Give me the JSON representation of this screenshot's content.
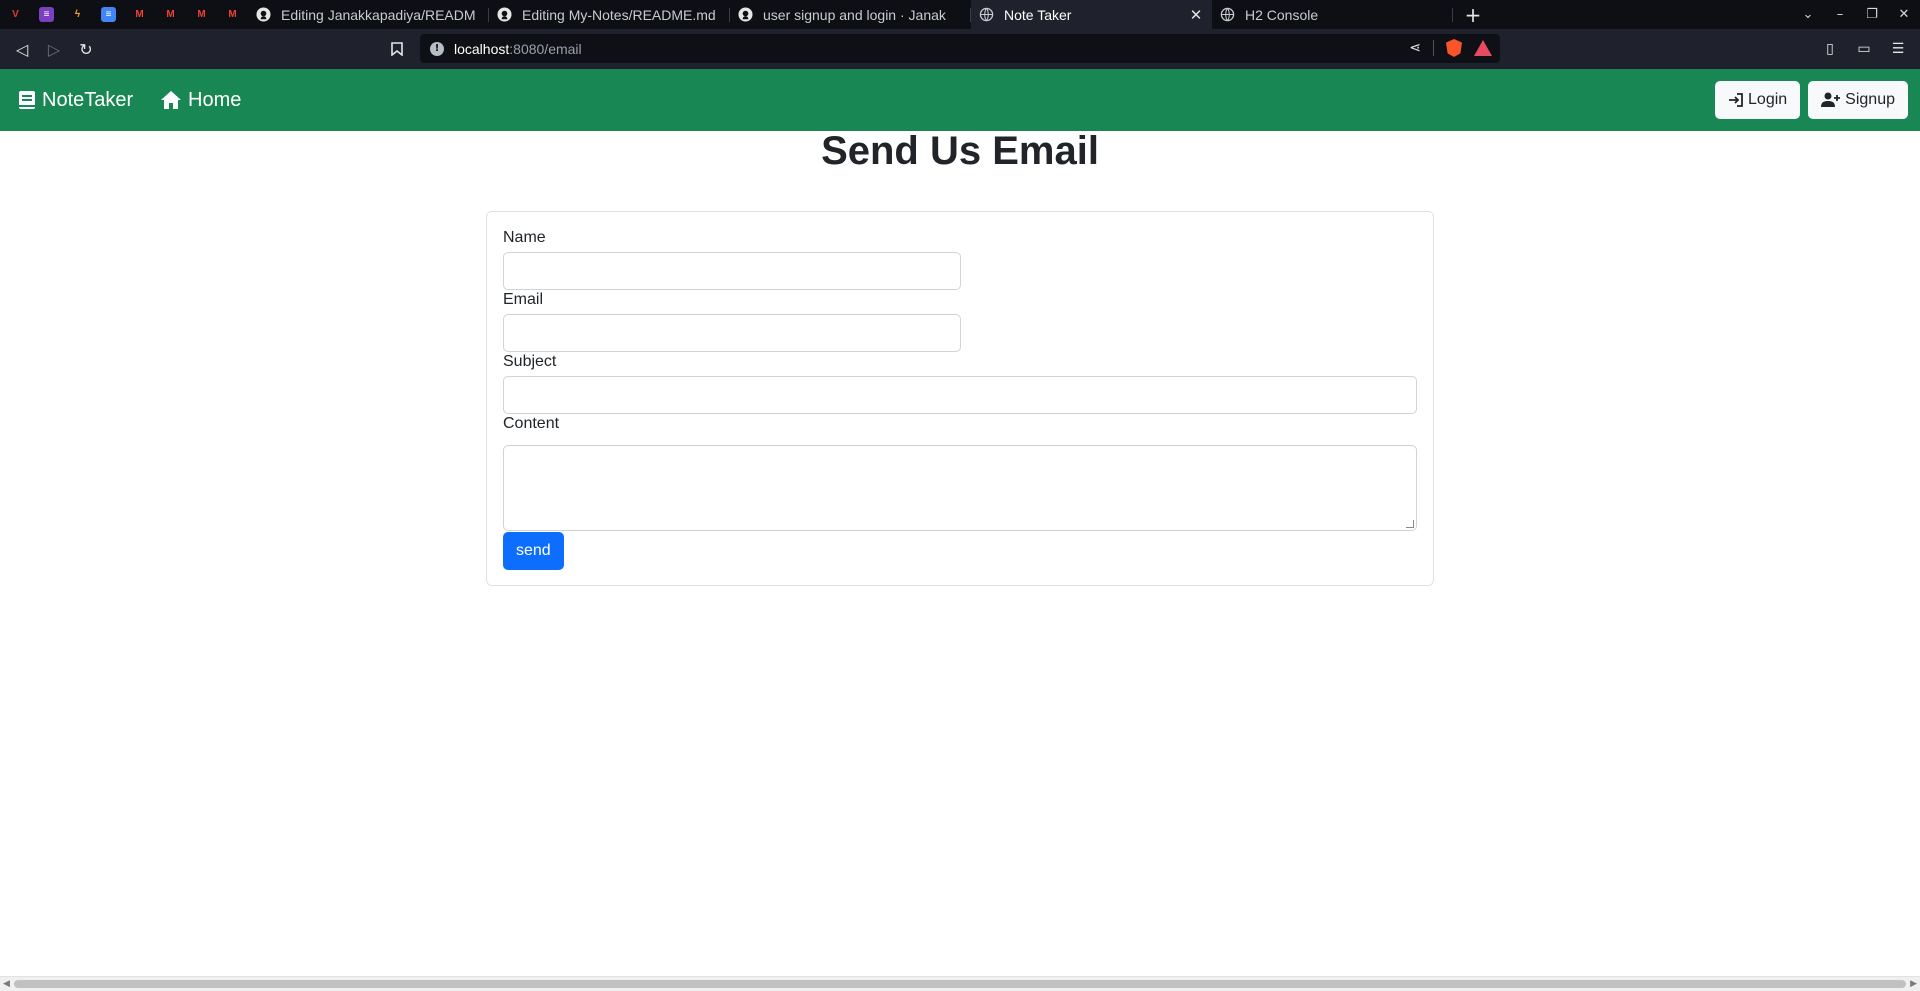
{
  "browser": {
    "pinned_tabs": [
      {
        "icon": "vivaldi-icon",
        "text": "V",
        "color": "#e53935",
        "bg": "transparent"
      },
      {
        "icon": "app-icon",
        "text": "≡",
        "color": "#ffffff",
        "bg": "#7b3fbf"
      },
      {
        "icon": "lightning-icon",
        "text": "ϟ",
        "color": "#f5a623",
        "bg": "transparent"
      },
      {
        "icon": "docs-icon",
        "text": "≡",
        "color": "#ffffff",
        "bg": "#4285f4"
      },
      {
        "icon": "gmail-icon",
        "text": "M",
        "color": "#ea4335",
        "bg": "transparent"
      },
      {
        "icon": "gmail-icon",
        "text": "M",
        "color": "#ea4335",
        "bg": "transparent"
      },
      {
        "icon": "gmail-icon",
        "text": "M",
        "color": "#ea4335",
        "bg": "transparent"
      },
      {
        "icon": "gmail-icon",
        "text": "M",
        "color": "#ea4335",
        "bg": "transparent"
      }
    ],
    "tabs": [
      {
        "label": "Editing Janakkapadiya/READM",
        "icon": "github-icon"
      },
      {
        "label": "Editing My-Notes/README.md",
        "icon": "github-icon"
      },
      {
        "label": "user signup and login · Janak",
        "icon": "github-icon"
      },
      {
        "label": "Note Taker",
        "icon": "globe-icon",
        "active": true
      },
      {
        "label": "H2 Console",
        "icon": "globe-icon"
      }
    ],
    "url_host": "localhost",
    "url_path": ":8080/email"
  },
  "app": {
    "brand": "NoteTaker",
    "home": "Home",
    "login": "Login",
    "signup": "Signup",
    "accent": "#198754"
  },
  "form": {
    "title": "Send Us Email",
    "name_label": "Name",
    "email_label": "Email",
    "subject_label": "Subject",
    "content_label": "Content",
    "send_label": "send",
    "button_color": "#0d6efd"
  }
}
